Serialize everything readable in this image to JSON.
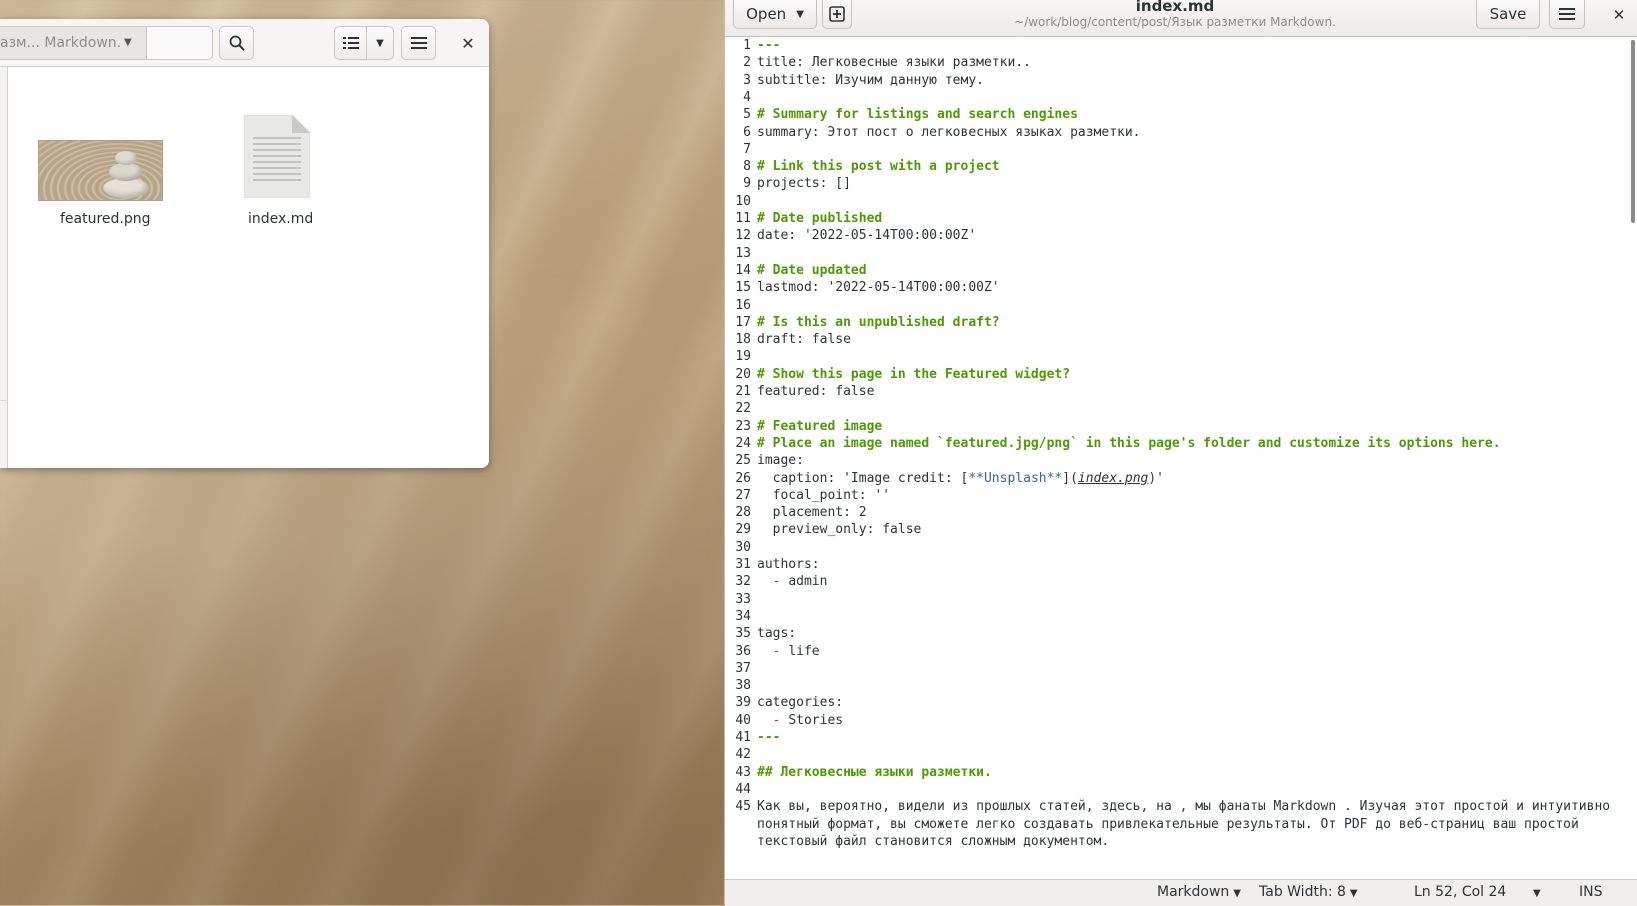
{
  "file_manager": {
    "path_current": "азм... Markdown.",
    "files": [
      {
        "name": "featured.png"
      },
      {
        "name": "index.md"
      }
    ],
    "icons": {
      "path_dropdown": "chevron-down-icon",
      "search": "search-icon",
      "view_list": "list-view-icon",
      "view_options": "chevron-down-icon",
      "menu": "hamburger-menu-icon",
      "close": "close-icon"
    }
  },
  "editor": {
    "open_label": "Open",
    "save_label": "Save",
    "title": "index.md",
    "subtitle": "~/work/blog/content/post/Язык разметки Markdown.",
    "lines": [
      {
        "n": "1",
        "text": "---",
        "style": "cm"
      },
      {
        "n": "2",
        "text": "title: Легковесные языки разметки..",
        "style": ""
      },
      {
        "n": "3",
        "text": "subtitle: Изучим данную тему.",
        "style": ""
      },
      {
        "n": "4",
        "text": "",
        "style": ""
      },
      {
        "n": "5",
        "text": "# Summary for listings and search engines",
        "style": "cm"
      },
      {
        "n": "6",
        "text": "summary: Этот пост о легковесных языках разметки.",
        "style": ""
      },
      {
        "n": "7",
        "text": "",
        "style": ""
      },
      {
        "n": "8",
        "text": "# Link this post with a project",
        "style": "cm"
      },
      {
        "n": "9",
        "text": "projects: []",
        "style": ""
      },
      {
        "n": "10",
        "text": "",
        "style": ""
      },
      {
        "n": "11",
        "text": "# Date published",
        "style": "cm"
      },
      {
        "n": "12",
        "text": "date: '2022-05-14T00:00:00Z'",
        "style": ""
      },
      {
        "n": "13",
        "text": "",
        "style": ""
      },
      {
        "n": "14",
        "text": "# Date updated",
        "style": "cm"
      },
      {
        "n": "15",
        "text": "lastmod: '2022-05-14T00:00:00Z'",
        "style": ""
      },
      {
        "n": "16",
        "text": "",
        "style": ""
      },
      {
        "n": "17",
        "text": "# Is this an unpublished draft?",
        "style": "cm"
      },
      {
        "n": "18",
        "text": "draft: false",
        "style": ""
      },
      {
        "n": "19",
        "text": "",
        "style": ""
      },
      {
        "n": "20",
        "text": "# Show this page in the Featured widget?",
        "style": "cm"
      },
      {
        "n": "21",
        "text": "featured: false",
        "style": ""
      },
      {
        "n": "22",
        "text": "",
        "style": ""
      },
      {
        "n": "23",
        "text": "# Featured image",
        "style": "cm"
      },
      {
        "n": "24",
        "text": "# Place an image named `featured.jpg/png` in this page's folder and customize its options here.",
        "style": "cm"
      },
      {
        "n": "25",
        "text": "image:",
        "style": ""
      },
      {
        "n": "26",
        "text": "",
        "style": "caption"
      },
      {
        "n": "27",
        "text": "  focal_point: ''",
        "style": ""
      },
      {
        "n": "28",
        "text": "  placement: 2",
        "style": ""
      },
      {
        "n": "29",
        "text": "  preview_only: false",
        "style": ""
      },
      {
        "n": "30",
        "text": "",
        "style": ""
      },
      {
        "n": "31",
        "text": "authors:",
        "style": ""
      },
      {
        "n": "32",
        "text": "admin",
        "style": "list"
      },
      {
        "n": "33",
        "text": "",
        "style": ""
      },
      {
        "n": "34",
        "text": "",
        "style": ""
      },
      {
        "n": "35",
        "text": "tags:",
        "style": ""
      },
      {
        "n": "36",
        "text": "life",
        "style": "list"
      },
      {
        "n": "37",
        "text": "",
        "style": ""
      },
      {
        "n": "38",
        "text": "",
        "style": ""
      },
      {
        "n": "39",
        "text": "categories:",
        "style": ""
      },
      {
        "n": "40",
        "text": "Stories",
        "style": "list"
      },
      {
        "n": "41",
        "text": "---",
        "style": "cm"
      },
      {
        "n": "42",
        "text": "",
        "style": ""
      },
      {
        "n": "43",
        "text": "## Легковесные языки разметки.",
        "style": "cm"
      },
      {
        "n": "44",
        "text": "",
        "style": ""
      },
      {
        "n": "45",
        "text": "Как вы, вероятно, видели из прошлых статей, здесь, на , мы фанаты Markdown . Изучая этот простой и интуитивно",
        "style": ""
      },
      {
        "n": "",
        "text": "понятный формат, вы сможете легко создавать привлекательные результаты. От PDF до веб-страниц ваш простой",
        "style": ""
      },
      {
        "n": "",
        "text": "текстовый файл становится сложным документом.",
        "style": ""
      }
    ],
    "caption_line": {
      "prefix": "  caption: 'Image credit: [",
      "link_text": "**Unsplash**",
      "middle": "](",
      "url": "index.png",
      "suffix": ")'"
    },
    "list_marker": "-",
    "status": {
      "language": "Markdown",
      "tab_width": "Tab Width: 8",
      "position": "Ln 52, Col 24",
      "mode": "INS"
    },
    "icons": {
      "open_dropdown": "chevron-down-icon",
      "new_document": "new-tab-icon",
      "menu": "hamburger-menu-icon",
      "close": "close-icon"
    }
  }
}
